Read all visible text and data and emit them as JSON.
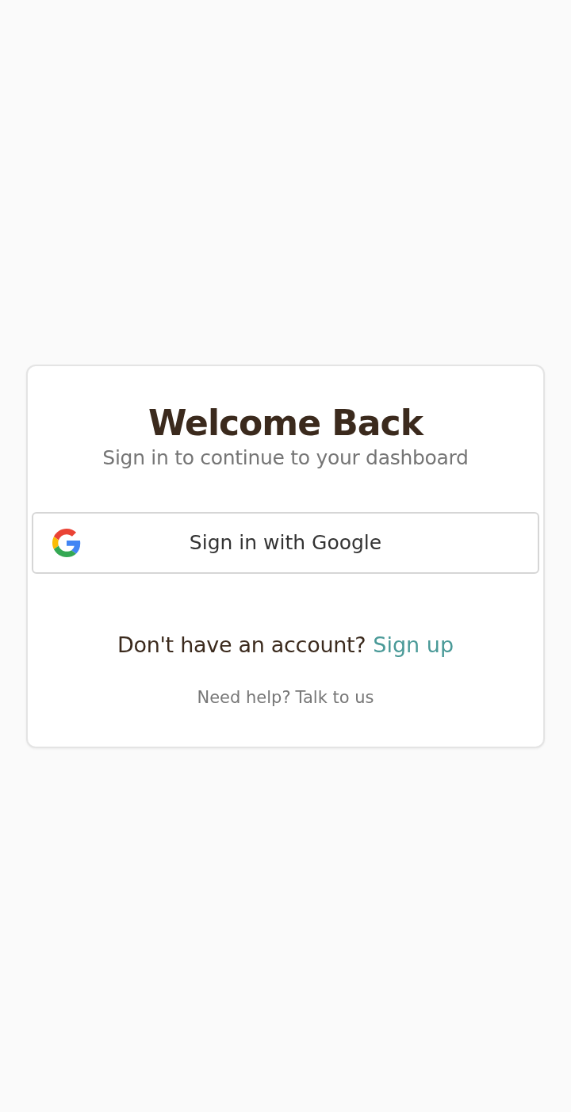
{
  "card": {
    "title": "Welcome Back",
    "subtitle": "Sign in to continue to your dashboard"
  },
  "google_button": {
    "label": "Sign in with Google"
  },
  "signup": {
    "text": "Don't have an account?",
    "link": "Sign up"
  },
  "help": {
    "text": "Need help?",
    "link": "Talk to us"
  }
}
